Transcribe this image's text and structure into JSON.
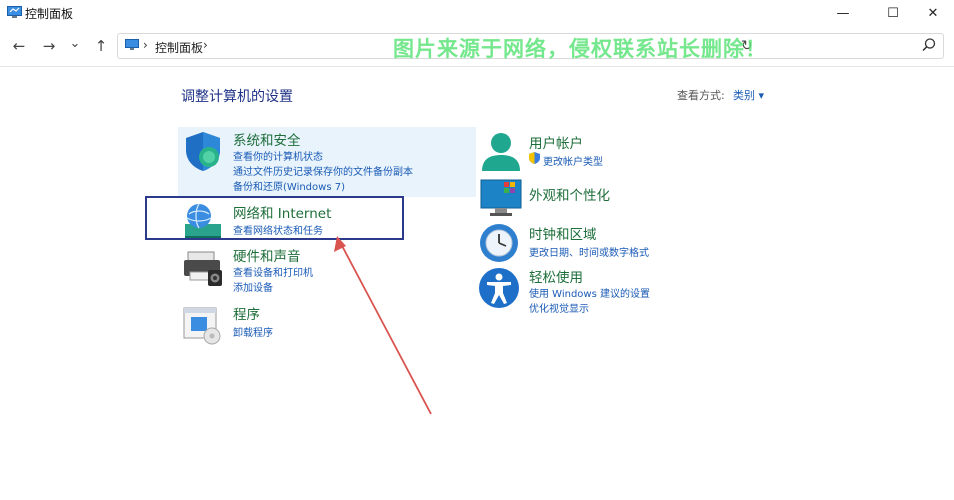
{
  "window": {
    "title": "控制面板",
    "minimize_glyph": "—",
    "maximize_glyph": "☐",
    "close_glyph": "✕"
  },
  "nav": {
    "back_glyph": "←",
    "forward_glyph": "→",
    "dropdown_glyph": "⌄",
    "up_glyph": "↑",
    "refresh_glyph": "↻"
  },
  "address": {
    "breadcrumb": "控制面板",
    "sep": "›"
  },
  "watermark": "图片来源于网络，侵权联系站长删除！",
  "main": {
    "heading": "调整计算机的设置",
    "view_by_label": "查看方式:",
    "view_by_value": "类别 ▾"
  },
  "categories": {
    "system": {
      "title": "系统和安全",
      "links": [
        "查看你的计算机状态",
        "通过文件历史记录保存你的文件备份副本",
        "备份和还原(Windows 7)"
      ],
      "icon": "shield-icon"
    },
    "network": {
      "title": "网络和 Internet",
      "links": [
        "查看网络状态和任务"
      ],
      "icon": "network-globe-icon"
    },
    "hardware": {
      "title": "硬件和声音",
      "links": [
        "查看设备和打印机",
        "添加设备"
      ],
      "icon": "printer-icon"
    },
    "programs": {
      "title": "程序",
      "links": [
        "卸载程序"
      ],
      "icon": "programs-icon"
    },
    "user": {
      "title": "用户帐户",
      "links": [
        "更改帐户类型"
      ],
      "icon": "user-icon"
    },
    "appearance": {
      "title": "外观和个性化",
      "links": [],
      "icon": "monitor-icon"
    },
    "clock": {
      "title": "时钟和区域",
      "links": [
        "更改日期、时间或数字格式"
      ],
      "icon": "clock-globe-icon"
    },
    "ease": {
      "title": "轻松使用",
      "links": [
        "使用 Windows 建议的设置",
        "优化视觉显示"
      ],
      "icon": "accessibility-icon"
    }
  },
  "colors": {
    "title_green": "#1e6e3a",
    "link_blue": "#1a5bb5",
    "heading_blue": "#1e3287",
    "highlight_box": "#2c3a8c",
    "arrow_red": "#d9534f",
    "watermark_green": "#5ee37a"
  }
}
